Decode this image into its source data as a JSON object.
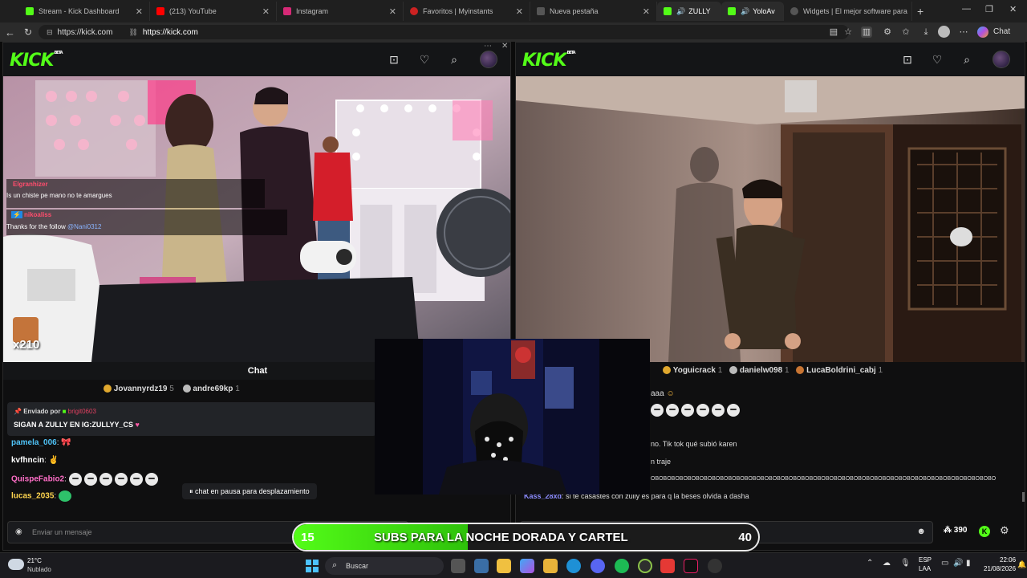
{
  "browser": {
    "tabs": [
      {
        "title": "Stream - Kick Dashboard",
        "color": "#53fc18"
      },
      {
        "title": "(213) YouTube",
        "color": "#ff0000"
      },
      {
        "title": "Instagram",
        "color": "#d62976"
      },
      {
        "title": "Favoritos | Myinstants",
        "color": "#cc2222"
      },
      {
        "title": "Nueva pestaña",
        "color": "#555555"
      },
      {
        "title": "ZULLY",
        "color": "#53fc18"
      },
      {
        "title": "YoloAv",
        "color": "#53fc18"
      },
      {
        "title": "Widgets | El mejor software para",
        "color": "#555555"
      }
    ],
    "url_left": "https://kick.com",
    "url_main": "https://kick.com",
    "chat_label": "Chat"
  },
  "left": {
    "logo": "KICK",
    "logo_badge": "BETA",
    "overlay_chat": [
      {
        "user": "Elgranhizer",
        "text": "Is un chiste pe mano no te amargues"
      },
      {
        "user": "nikoaliss",
        "text": "Thanks for the follow ",
        "mention": "@Nani0312"
      }
    ],
    "gift_count": "x210",
    "chat_title": "Chat",
    "top_gifters": [
      {
        "name": "Jovannyrdz19",
        "count": "5"
      },
      {
        "name": "andre69kp",
        "count": "1"
      }
    ],
    "pinned_by_label": "Enviado por",
    "pinned_by_user": "brigit0603",
    "pinned_text": "SIGAN A ZULLY EN IG:ZULLYY_CS",
    "messages": [
      {
        "user": "pamela_006",
        "color": "#4fc3f7",
        "text": ""
      },
      {
        "user": "kvfhncin",
        "color": "#ffffff",
        "text": ""
      },
      {
        "user": "QuispeFabio2",
        "color": "#ff6ec7",
        "text": ""
      },
      {
        "user": "lucas_2035",
        "color": "#ffd54f",
        "text": ""
      }
    ],
    "paused_label": "chat en pausa para desplazamiento",
    "input_placeholder": "Enviar un mensaje"
  },
  "right": {
    "logo": "KICK",
    "logo_badge": "BETA",
    "top_gifters": [
      {
        "name": "Yoguicrack",
        "count": "1"
      },
      {
        "name": "danielw098",
        "count": "1"
      },
      {
        "name": "LucaBoldrini_cabj",
        "count": "1"
      }
    ],
    "messages": [
      {
        "text": "aaa"
      },
      {
        "text": "no. Tik tok qué subió karen"
      },
      {
        "text": "n traje"
      },
      {
        "text": "OBOBOBOBOBOBOBOBOBOBOBOBOBOBOBOBOBOBOBOBOBOBOBOBOBOBOBOBOBOBOBOBOBOBOBOBOBOBOBOBOBOBO"
      },
      {
        "user": "Kass_28xd",
        "text": ": si te casastes con zully es para q la beses olvida a dasha"
      }
    ],
    "viewer_count": "390"
  },
  "goal_bar": {
    "current": "15",
    "text": "SUBS PARA LA NOCHE DORADA Y CARTEL",
    "target": "40",
    "progress": 0.375
  },
  "taskbar": {
    "weather_temp": "21°C",
    "weather_desc": "Nublado",
    "search_label": "Buscar",
    "lang_top": "ESP",
    "lang_bottom": "LAA",
    "time": "22:06",
    "date": "21/08/2026"
  }
}
